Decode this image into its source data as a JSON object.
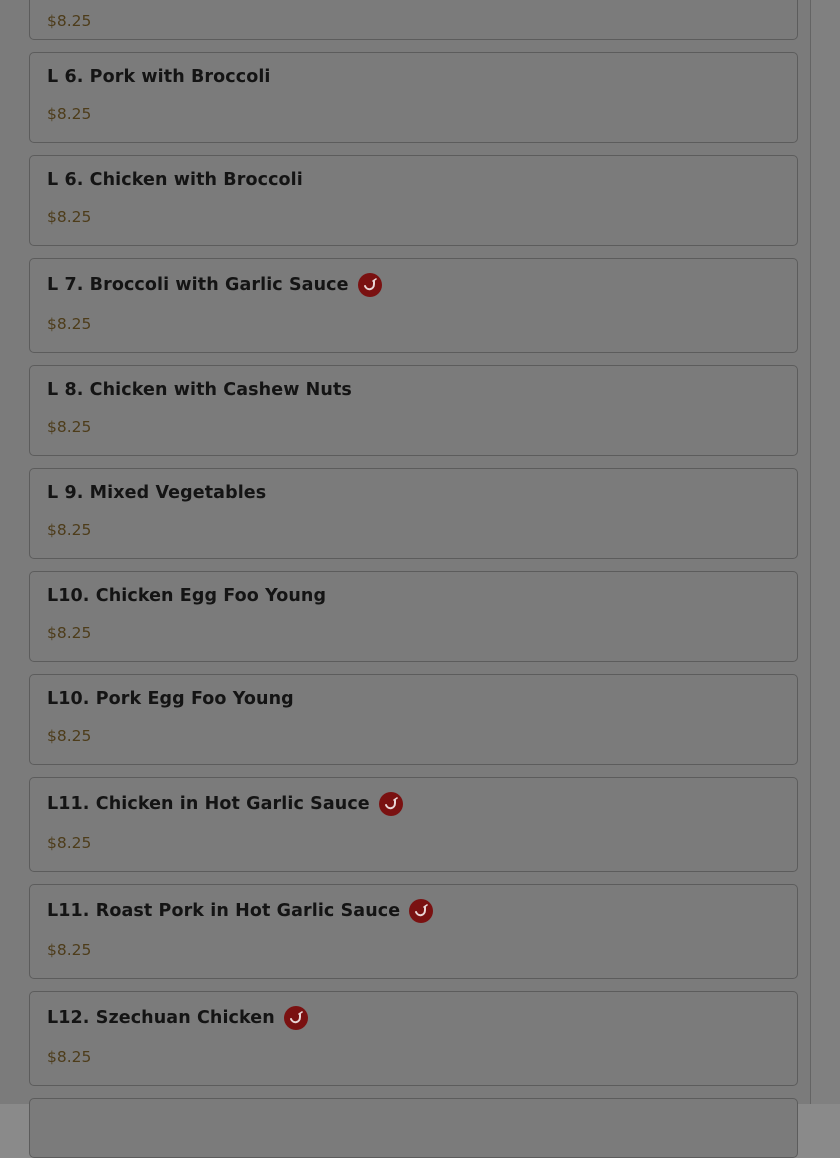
{
  "menu": {
    "items": [
      {
        "name": "",
        "price": "$8.25",
        "spicy": false
      },
      {
        "name": "L 6. Pork with Broccoli",
        "price": "$8.25",
        "spicy": false
      },
      {
        "name": "L 6. Chicken with Broccoli",
        "price": "$8.25",
        "spicy": false
      },
      {
        "name": "L 7. Broccoli with Garlic Sauce",
        "price": "$8.25",
        "spicy": true
      },
      {
        "name": "L 8. Chicken with Cashew Nuts",
        "price": "$8.25",
        "spicy": false
      },
      {
        "name": "L 9. Mixed Vegetables",
        "price": "$8.25",
        "spicy": false
      },
      {
        "name": "L10. Chicken Egg Foo Young",
        "price": "$8.25",
        "spicy": false
      },
      {
        "name": "L10. Pork Egg Foo Young",
        "price": "$8.25",
        "spicy": false
      },
      {
        "name": "L11. Chicken in Hot Garlic Sauce",
        "price": "$8.25",
        "spicy": true
      },
      {
        "name": "L11. Roast Pork in Hot Garlic Sauce",
        "price": "$8.25",
        "spicy": true
      },
      {
        "name": "L12. Szechuan Chicken",
        "price": "$8.25",
        "spicy": true
      },
      {
        "name": "",
        "price": "",
        "spicy": false
      }
    ]
  },
  "colors": {
    "overlay": "#7b7b7b",
    "spicy_badge": "#7a1111",
    "price_text": "#4d3c1a"
  },
  "icons": {
    "spicy": "chili-pepper-icon"
  }
}
